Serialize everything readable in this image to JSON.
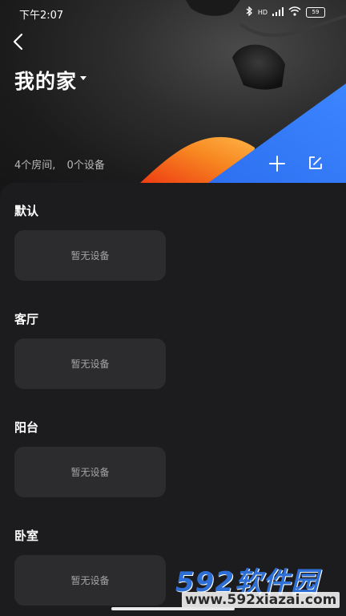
{
  "status_bar": {
    "time": "下午2:07",
    "network": "HD",
    "battery": "59"
  },
  "header": {
    "title": "我的家",
    "summary_rooms": "4个房间,",
    "summary_devices": "0个设备"
  },
  "rooms": [
    {
      "name": "默认",
      "empty_text": "暂无设备"
    },
    {
      "name": "客厅",
      "empty_text": "暂无设备"
    },
    {
      "name": "阳台",
      "empty_text": "暂无设备"
    },
    {
      "name": "卧室",
      "empty_text": "暂无设备"
    }
  ],
  "watermark": {
    "logo": "592软件园",
    "url": "www.592xiazai.com"
  },
  "colors": {
    "background": "#1c1c1e",
    "card": "#2c2c2e",
    "accent_blue": "#2f7bf5",
    "accent_orange": "#f5751e"
  }
}
